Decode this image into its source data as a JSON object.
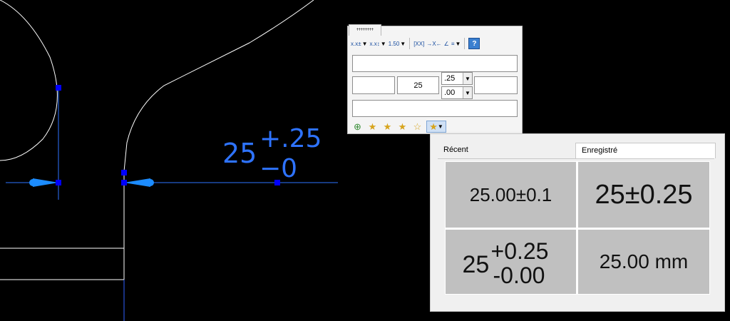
{
  "canvas": {
    "dimension_text": {
      "base": "25",
      "upper": "+.25",
      "lower": "−0"
    },
    "colors": {
      "geometry": "#ffffff",
      "dimension": "#2e73ff",
      "grip": "#0000ff"
    }
  },
  "panel": {
    "toolbar": [
      {
        "name": "tolerance-format-button",
        "glyph": "x.x±",
        "has_dropdown": true
      },
      {
        "name": "tolerance-stack-button",
        "glyph": "x.x↕",
        "has_dropdown": true
      },
      {
        "name": "precision-button",
        "glyph": "1.50",
        "has_dropdown": true
      },
      {
        "name": "basic-dimension-button",
        "glyph": "[XX]",
        "has_dropdown": false
      },
      {
        "name": "reference-dimension-button",
        "glyph": "→X←",
        "has_dropdown": false
      },
      {
        "name": "angle-button",
        "glyph": "∠",
        "has_dropdown": false
      },
      {
        "name": "justify-button",
        "glyph": "≡",
        "has_dropdown": true
      }
    ],
    "help_label": "?",
    "fields": {
      "top_text": "",
      "left_text": "",
      "value": "25",
      "upper_tol": ".25",
      "lower_tol": ".00",
      "right_text": "",
      "bottom_text": ""
    },
    "bottom_icons": [
      "add-style-icon",
      "add-favorite-icon",
      "delete-favorite-icon",
      "save-favorite-icon",
      "favorites-icon",
      "favorites-dropdown-icon"
    ]
  },
  "flyout": {
    "tabs": [
      "Récent",
      "Enregistré"
    ],
    "active_tab": "Enregistré",
    "presets": {
      "p1": "25.00±0.1",
      "p2": "25±0.25",
      "p3": {
        "base": "25",
        "upper": "+0.25",
        "lower": "-0.00"
      },
      "p4": "25.00 mm"
    }
  }
}
